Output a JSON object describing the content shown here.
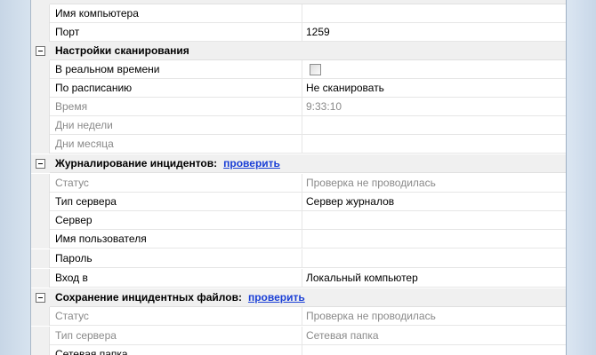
{
  "rows": [
    {
      "name": "Имя компьютера",
      "value": ""
    },
    {
      "name": "Порт",
      "value": "1259"
    }
  ],
  "scan": {
    "title": "Настройки сканирования",
    "rows": [
      {
        "name": "В реальном времени",
        "checked": false
      },
      {
        "name": "По расписанию",
        "value": "Не сканировать"
      },
      {
        "name": "Время",
        "value": "9:33:10"
      },
      {
        "name": "Дни недели",
        "value": ""
      },
      {
        "name": "Дни месяца",
        "value": ""
      }
    ]
  },
  "incident_log": {
    "title": "Журналирование инцидентов:",
    "link": "проверить",
    "rows": [
      {
        "name": "Статус",
        "value": "Проверка не проводилась"
      },
      {
        "name": "Тип сервера",
        "value": "Сервер журналов"
      },
      {
        "name": "Сервер",
        "value": ""
      },
      {
        "name": "Имя пользователя",
        "value": ""
      },
      {
        "name": "Пароль",
        "value": ""
      },
      {
        "name": "Вход в",
        "value": "Локальный компьютер"
      }
    ]
  },
  "incident_files": {
    "title": "Сохранение инцидентных файлов:",
    "link": "проверить",
    "rows": [
      {
        "name": "Статус",
        "value": "Проверка не проводилась"
      },
      {
        "name": "Тип сервера",
        "value": "Сетевая папка"
      },
      {
        "name": "Сетевая папка",
        "value": ""
      }
    ]
  }
}
